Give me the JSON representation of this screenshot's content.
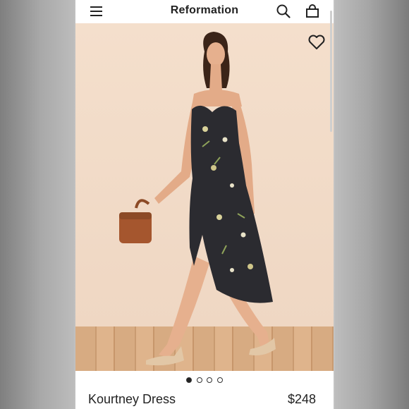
{
  "header": {
    "brand": "Reformation",
    "menu_icon": "hamburger-menu-icon",
    "search_icon": "search-icon",
    "bag_icon": "shopping-bag-icon"
  },
  "product": {
    "name": "Kourtney Dress",
    "price": "$248",
    "favorite_icon": "heart-outline-icon",
    "image_alt": "Model in a dark floral midi dress holding a brown bag",
    "carousel": {
      "total": 4,
      "active_index": 0
    }
  },
  "colors": {
    "background": "#ffffff",
    "text": "#222222",
    "photo_wall": "#f1dac7",
    "photo_floor": "#d7ab82",
    "dress": "#2b2b30"
  }
}
